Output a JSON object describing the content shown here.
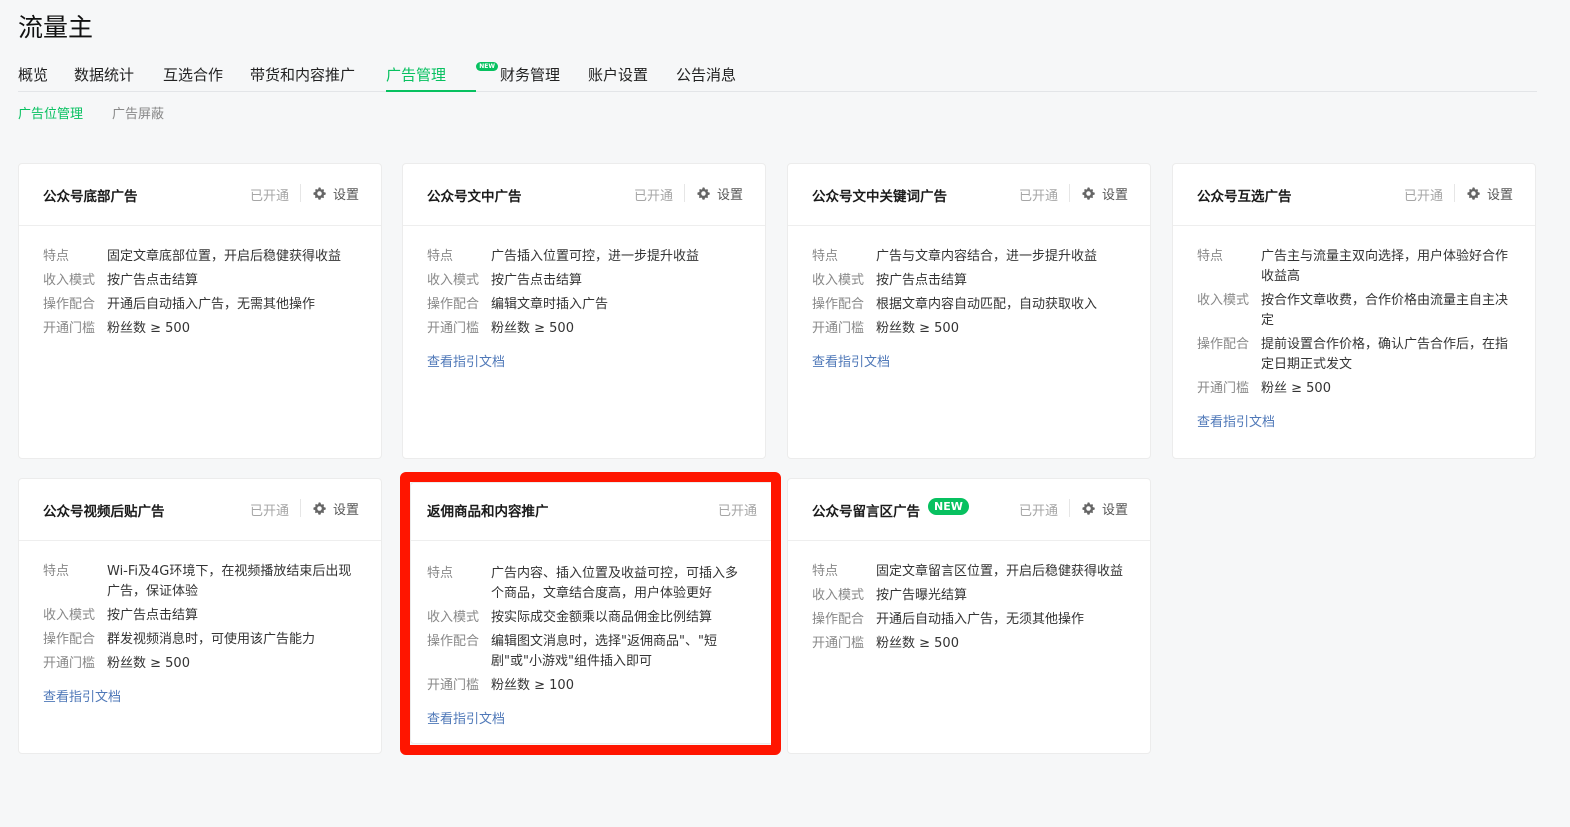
{
  "app": {
    "title": "流量主"
  },
  "nav": {
    "items": [
      "概览",
      "数据统计",
      "互选合作",
      "带货和内容推广",
      "广告管理",
      "财务管理",
      "账户设置",
      "公告消息"
    ],
    "new_tag": "NEW"
  },
  "subnav": {
    "items": [
      "广告位管理",
      "广告屏蔽"
    ]
  },
  "labels": {
    "feature": "特点",
    "income": "收入模式",
    "operation": "操作配合",
    "threshold": "开通门槛",
    "status": "已开通",
    "settings": "设置",
    "guide": "查看指引文档",
    "new_badge": "NEW"
  },
  "cards": [
    {
      "title": "公众号底部广告",
      "feature": "固定文章底部位置，开启后稳健获得收益",
      "income": "按广告点击结算",
      "operation": "开通后自动插入广告，无需其他操作",
      "threshold": "粉丝数 ≥ 500"
    },
    {
      "title": "公众号文中广告",
      "feature": "广告插入位置可控，进一步提升收益",
      "income": "按广告点击结算",
      "operation": "编辑文章时插入广告",
      "threshold": "粉丝数 ≥ 500"
    },
    {
      "title": "公众号文中关键词广告",
      "feature": "广告与文章内容结合，进一步提升收益",
      "income": "按广告点击结算",
      "operation": "根据文章内容自动匹配，自动获取收入",
      "threshold": "粉丝数 ≥ 500"
    },
    {
      "title": "公众号互选广告",
      "feature": "广告主与流量主双向选择，用户体验好合作收益高",
      "income": "按合作文章收费，合作价格由流量主自主决定",
      "operation": "提前设置合作价格，确认广告合作后，在指定日期正式发文",
      "threshold": "粉丝 ≥ 500"
    },
    {
      "title": "公众号视频后贴广告",
      "feature": "Wi-Fi及4G环境下，在视频播放结束后出现广告，保证体验",
      "income": "按广告点击结算",
      "operation": "群发视频消息时，可使用该广告能力",
      "threshold": "粉丝数 ≥ 500"
    },
    {
      "title": "返佣商品和内容推广",
      "feature": "广告内容、插入位置及收益可控，可插入多个商品，文章结合度高，用户体验更好",
      "income": "按实际成交金额乘以商品佣金比例结算",
      "operation": "编辑图文消息时，选择\"返佣商品\"、\"短剧\"或\"小游戏\"组件插入即可",
      "threshold": "粉丝数 ≥ 100"
    },
    {
      "title": "公众号留言区广告",
      "feature": "固定文章留言区位置，开启后稳健获得收益",
      "income": "按广告曝光结算",
      "operation": "开通后自动插入广告，无须其他操作",
      "threshold": "粉丝数 ≥ 500"
    }
  ],
  "colors": {
    "accent": "#07c160",
    "link": "#4f78b8",
    "highlight": "#ff1500"
  }
}
